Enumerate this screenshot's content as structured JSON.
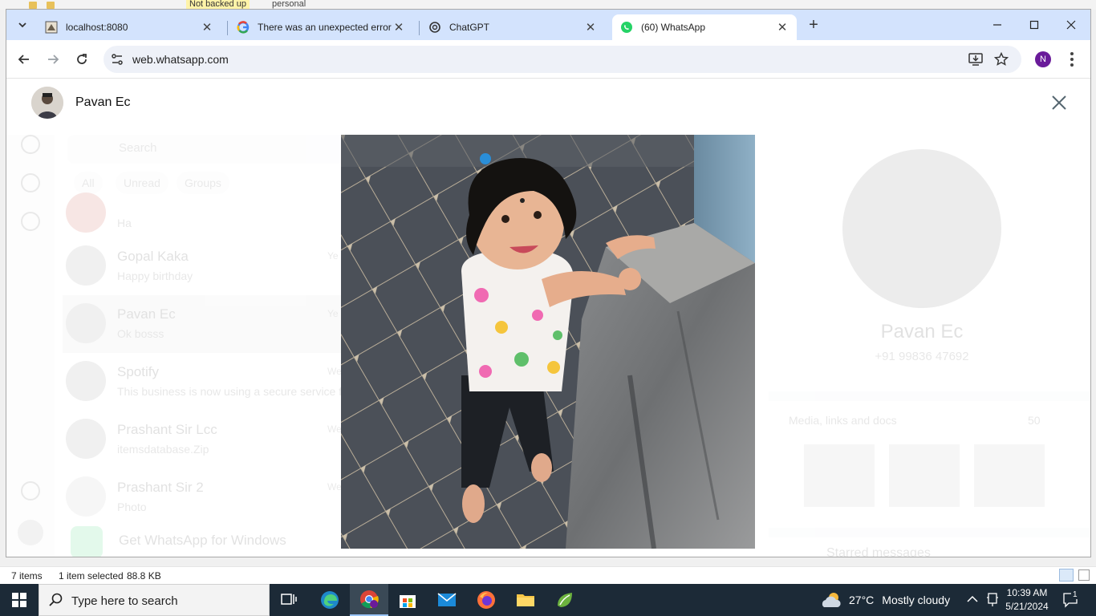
{
  "background_window": {
    "top_tags": [
      "Not backed up",
      "personal"
    ],
    "status": {
      "items_count": "7 items",
      "selected": "1 item selected",
      "size": "88.8 KB"
    }
  },
  "browser": {
    "tabs": [
      {
        "title": "localhost:8080",
        "icon": "puzzle-icon"
      },
      {
        "title": "There was an unexpected error",
        "icon": "google-icon"
      },
      {
        "title": "ChatGPT",
        "icon": "chatgpt-icon"
      },
      {
        "title": "(60) WhatsApp",
        "icon": "whatsapp-icon"
      }
    ],
    "url": "web.whatsapp.com",
    "profile_initial": "N"
  },
  "viewer": {
    "contact_name": "Pavan Ec"
  },
  "whatsapp_background": {
    "search_placeholder": "Search",
    "filters": [
      "All",
      "Unread",
      "Groups"
    ],
    "chats": [
      {
        "name": "",
        "message": "Ha",
        "time": ""
      },
      {
        "name": "Gopal Kaka",
        "message": "Happy birthday",
        "time": "Ye"
      },
      {
        "name": "Pavan Ec",
        "message": "Ok bosss",
        "time": "Ye"
      },
      {
        "name": "Spotify",
        "message": "This business is now using a secure service fr",
        "time": "Wed"
      },
      {
        "name": "Prashant Sir Lcc",
        "message": "itemsdatabase.Zip",
        "time": "Wed"
      },
      {
        "name": "Prashant Sir 2",
        "message": "Photo",
        "time": "Wed"
      },
      {
        "name": "Get WhatsApp for Windows",
        "message": "",
        "time": ""
      }
    ],
    "profile": {
      "name": "Pavan Ec",
      "phone": "+91 99836 47692",
      "media_label": "Media, links and docs",
      "media_count": "50",
      "starred": "Starred messages"
    }
  },
  "taskbar": {
    "search_placeholder": "Type here to search",
    "weather": {
      "temp": "27°C",
      "condition": "Mostly cloudy"
    },
    "time": "10:39 AM",
    "date": "5/21/2024",
    "notification_count": "1"
  },
  "colors": {
    "tabstrip": "#d3e3fd",
    "omnibox": "#eef1f8",
    "taskbar": "#1c2a37",
    "whatsapp_green": "#25d366",
    "profile_purple": "#6a1b9a"
  }
}
